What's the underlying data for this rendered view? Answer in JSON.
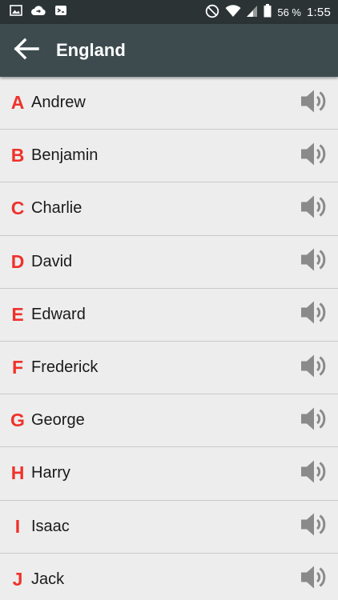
{
  "status_bar": {
    "battery_percent": "56 %",
    "time": "1:55",
    "icons": [
      "image-icon",
      "cloud-sync-icon",
      "shield-icon",
      "do-not-disturb-icon",
      "wifi-icon",
      "signal-icon",
      "battery-icon"
    ]
  },
  "app_bar": {
    "title": "England",
    "back_icon": "arrow-left-icon"
  },
  "names": [
    {
      "letter": "A",
      "name": "Andrew"
    },
    {
      "letter": "B",
      "name": "Benjamin"
    },
    {
      "letter": "C",
      "name": "Charlie"
    },
    {
      "letter": "D",
      "name": "David"
    },
    {
      "letter": "E",
      "name": "Edward"
    },
    {
      "letter": "F",
      "name": "Frederick"
    },
    {
      "letter": "G",
      "name": "George"
    },
    {
      "letter": "H",
      "name": "Harry"
    },
    {
      "letter": "I",
      "name": "Isaac"
    },
    {
      "letter": "J",
      "name": "Jack"
    }
  ],
  "colors": {
    "status_bar_bg": "#2b3335",
    "app_bar_bg": "#3d4b4f",
    "letter_red": "#f0312a",
    "list_bg": "#ededed",
    "speaker_gray": "#8a8a8a"
  }
}
